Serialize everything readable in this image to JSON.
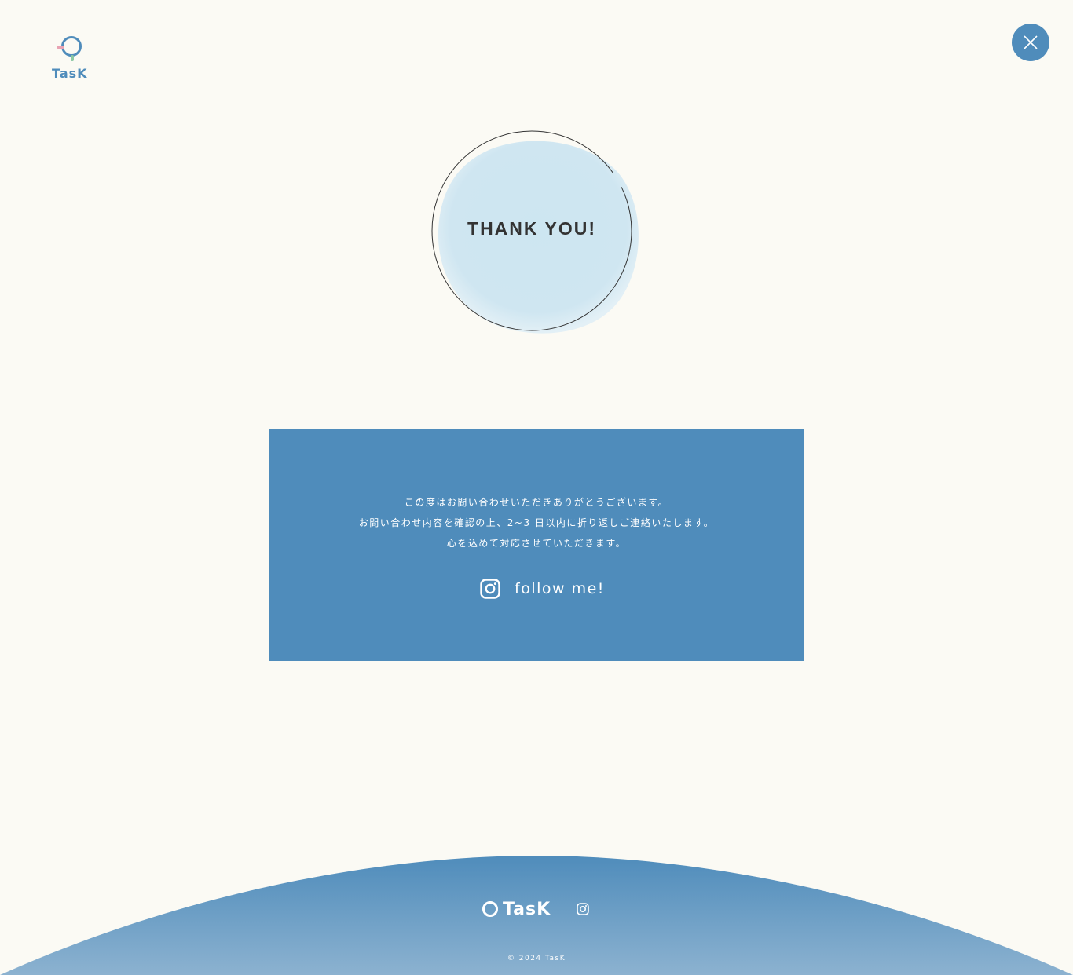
{
  "header": {
    "logo_text": "TasK",
    "close_icon": "close-icon"
  },
  "hero": {
    "title": "THANK YOU!"
  },
  "message": {
    "lines": [
      "この度はお問い合わせいただきありがとうございます。",
      "お問い合わせ内容を確認の上、2~3 日以内に折り返しご連絡いたします。",
      "心を込めて対応させていただきます。"
    ],
    "follow_label": "follow me!",
    "follow_icon": "instagram-icon"
  },
  "footer": {
    "logo_text": "TasK",
    "instagram_icon": "instagram-icon",
    "copyright": "© 2024 TasK"
  },
  "colors": {
    "accent": "#4f8cbb",
    "background": "#fbfaf4",
    "watercolor": "#cfe6f1"
  }
}
